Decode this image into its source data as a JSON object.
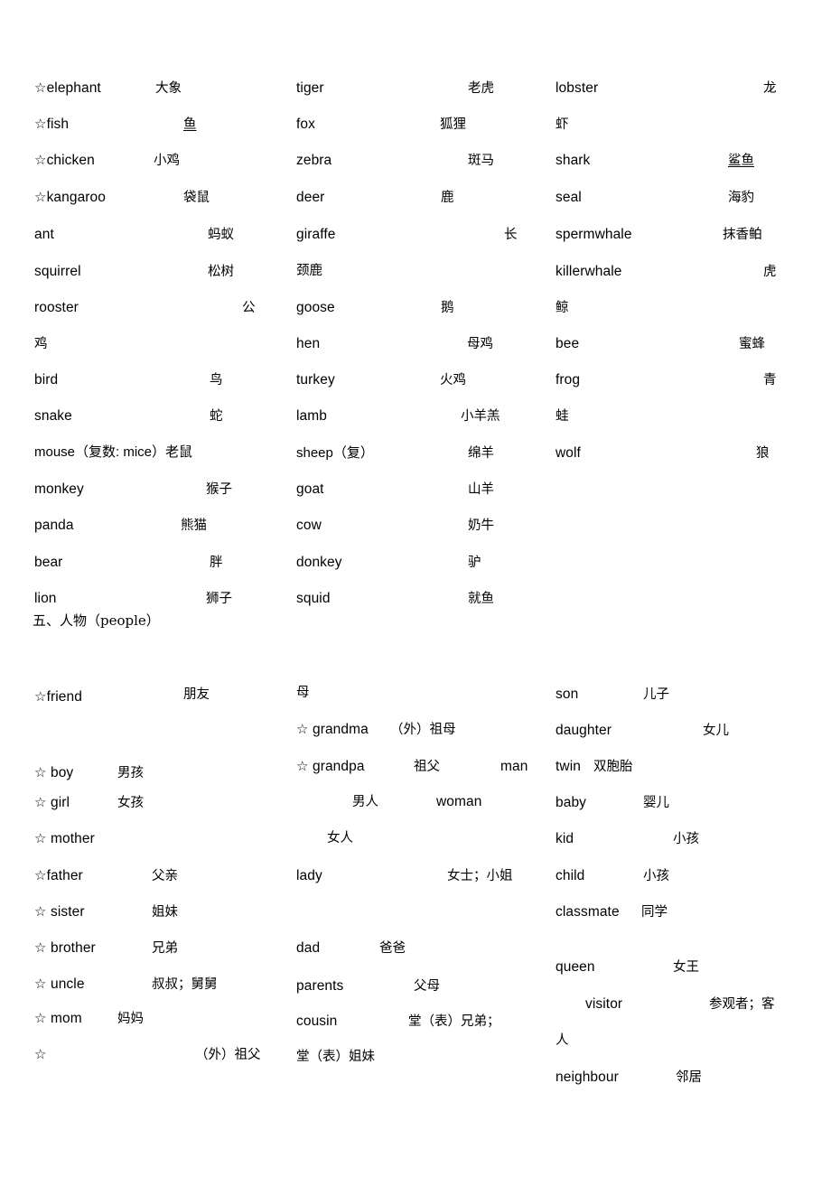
{
  "document": {
    "title": "English-Chinese vocabulary list: animals and people",
    "sections": [
      {
        "id": "animals",
        "heading": null
      },
      {
        "id": "people",
        "heading": "五、人物（people）"
      }
    ]
  },
  "glyphs": {
    "star": "☆"
  },
  "animals": {
    "col1": [
      {
        "star": "☆",
        "en": "elephant",
        "zh": "大象"
      },
      {
        "star": "☆",
        "en": "fish",
        "zh": "鱼",
        "underline": true
      },
      {
        "star": "☆",
        "en": "chicken",
        "zh": "小鸡"
      },
      {
        "star": "☆",
        "en": "kangaroo",
        "zh": "袋鼠"
      },
      {
        "star": "",
        "en": "ant",
        "zh": "蚂蚁"
      },
      {
        "star": "",
        "en": "squirrel",
        "zh": "松树"
      },
      {
        "star": "",
        "en": "rooster",
        "zh": "公"
      },
      {
        "star": "",
        "en": "",
        "zh": "鸡"
      },
      {
        "star": "",
        "en": "bird",
        "zh": "鸟"
      },
      {
        "star": "",
        "en": "snake",
        "zh": "蛇"
      },
      {
        "star": "",
        "en": "mouse（复数: mice）老鼠",
        "zh": ""
      },
      {
        "star": "",
        "en": "monkey",
        "zh": "猴子"
      },
      {
        "star": "",
        "en": "panda",
        "zh": "熊猫"
      },
      {
        "star": "",
        "en": "bear",
        "zh": "胖"
      },
      {
        "star": "",
        "en": "lion",
        "zh": "狮子"
      }
    ],
    "col2": [
      {
        "en": "tiger",
        "zh": "老虎"
      },
      {
        "en": "fox",
        "zh": "狐狸"
      },
      {
        "en": "zebra",
        "zh": "斑马"
      },
      {
        "en": "deer",
        "zh": "鹿"
      },
      {
        "en": "giraffe",
        "zh": "长"
      },
      {
        "en": "",
        "zh": "颈鹿"
      },
      {
        "en": "goose",
        "zh": "鹅"
      },
      {
        "en": "hen",
        "zh": "母鸡"
      },
      {
        "en": "turkey",
        "zh": "火鸡"
      },
      {
        "en": "lamb",
        "zh": "小羊羔"
      },
      {
        "en": "sheep（复）",
        "zh": "绵羊"
      },
      {
        "en": "goat",
        "zh": "山羊"
      },
      {
        "en": "cow",
        "zh": "奶牛"
      },
      {
        "en": "donkey",
        "zh": "驴"
      },
      {
        "en": "squid",
        "zh": "就鱼"
      }
    ],
    "col3": [
      {
        "en": "lobster",
        "zh": "龙"
      },
      {
        "en": "",
        "zh": "虾"
      },
      {
        "en": "shark",
        "zh": "鲨鱼",
        "underline": true
      },
      {
        "en": "seal",
        "zh": "海豹"
      },
      {
        "en": "spermwhale",
        "zh": "抹香鲌"
      },
      {
        "en": "killerwhale",
        "zh": "虎"
      },
      {
        "en": "",
        "zh": "鲸"
      },
      {
        "en": "bee",
        "zh": "蜜蜂"
      },
      {
        "en": "frog",
        "zh": "青"
      },
      {
        "en": "",
        "zh": "蛙"
      },
      {
        "en": "wolf",
        "zh": "狼"
      }
    ]
  },
  "people": {
    "heading": "五、人物（people）",
    "col1": [
      {
        "star": "☆",
        "en": "friend",
        "zh": "朋友"
      },
      {
        "star": "☆",
        "en": "boy",
        "zh": "男孩"
      },
      {
        "star": "☆",
        "en": "girl",
        "zh": "女孩"
      },
      {
        "star": "☆",
        "en": "mother",
        "zh": ""
      },
      {
        "star": "☆",
        "en": "father",
        "zh": "父亲"
      },
      {
        "star": "☆",
        "en": "sister",
        "zh": "姐妹"
      },
      {
        "star": "☆",
        "en": "brother",
        "zh": "兄弟"
      },
      {
        "star": "☆",
        "en": "uncle",
        "zh": "叔叔；舅舅"
      },
      {
        "star": "☆",
        "en": "mom",
        "zh": "妈妈"
      },
      {
        "star": "☆",
        "en": "",
        "zh": "（外）祖父"
      }
    ],
    "col2": [
      {
        "star": "",
        "en": "",
        "zh": "母"
      },
      {
        "star": "☆",
        "en": "grandma",
        "zh": "（外）祖母"
      },
      {
        "star": "☆",
        "en": "grandpa",
        "zh": "祖父"
      },
      {
        "star": "",
        "en": "man",
        "zh": "男人"
      },
      {
        "star": "",
        "en": "woman",
        "zh": "女人"
      },
      {
        "star": "",
        "en": "lady",
        "zh": "女士；小姐"
      },
      {
        "star": "",
        "en": "dad",
        "zh": "爸爸"
      },
      {
        "star": "",
        "en": "parents",
        "zh": "父母"
      },
      {
        "star": "",
        "en": "cousin",
        "zh": "堂（表）兄弟；"
      },
      {
        "star": "",
        "en": "",
        "zh": "堂（表）姐妹"
      }
    ],
    "col3": [
      {
        "en": "son",
        "zh": "儿子"
      },
      {
        "en": "daughter",
        "zh": "女儿"
      },
      {
        "en": "twin",
        "zh": "双胞胎"
      },
      {
        "en": "baby",
        "zh": "婴儿"
      },
      {
        "en": "kid",
        "zh": "小孩"
      },
      {
        "en": "child",
        "zh": "小孩"
      },
      {
        "en": "classmate",
        "zh": "同学"
      },
      {
        "en": "queen",
        "zh": "女王"
      },
      {
        "en": "visitor",
        "zh": "参观者；客"
      },
      {
        "en": "",
        "zh": "人"
      },
      {
        "en": "neighbour",
        "zh": "邻居"
      }
    ]
  }
}
